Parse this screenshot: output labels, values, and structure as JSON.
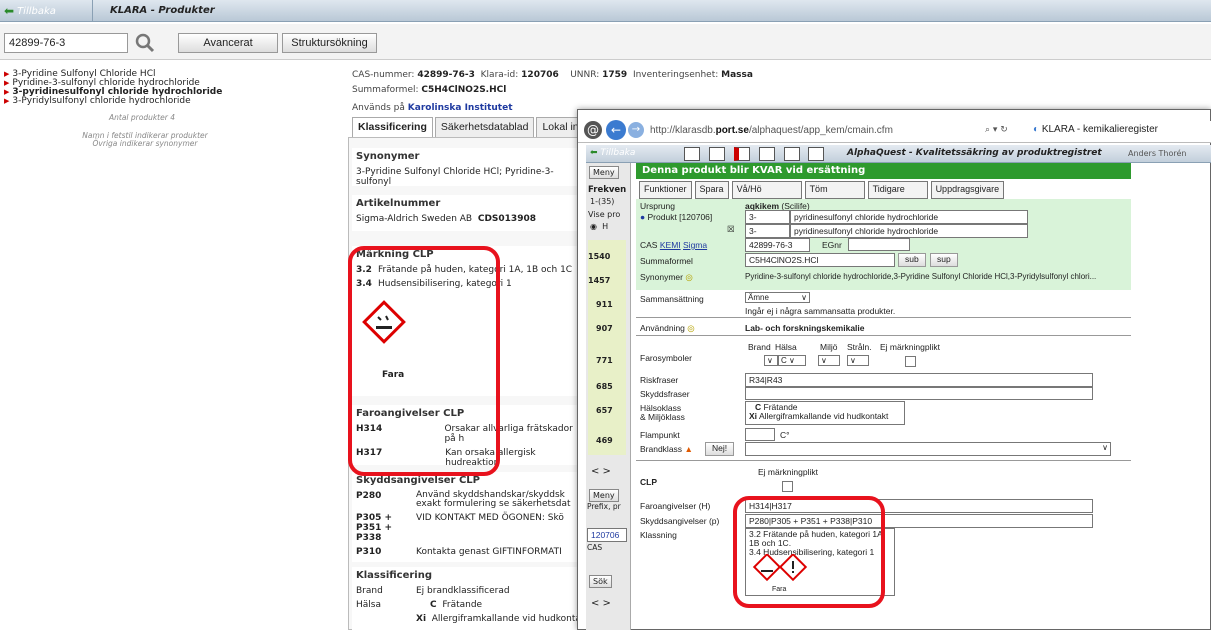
{
  "app": {
    "back_label": "Tillbaka",
    "title": "KLARA - Produkter"
  },
  "search": {
    "value": "42899-76-3",
    "advanced_label": "Avancerat",
    "structure_label": "Struktursökning"
  },
  "products": [
    "3-Pyridine Sulfonyl Chloride HCl",
    "Pyridine-3-sulfonyl chloride hydrochloride",
    "3-pyridinesulfonyl chloride hydrochloride",
    "3-Pyridylsulfonyl chloride hydrochloride"
  ],
  "product_count": "Antal produkter 4",
  "notes": [
    "Namn i fetstil indikerar produkter",
    "Övriga indikerar synonymer"
  ],
  "info": {
    "cas_label": "CAS-nummer:",
    "cas": "42899-76-3",
    "klara_label": "Klara-id:",
    "klara": "120706",
    "unnr_label": "UNNR:",
    "unnr": "1759",
    "unit_label": "Inventeringsenhet:",
    "unit": "Massa",
    "formula_label": "Summaformel:",
    "formula": "C5H4ClNO2S.HCl",
    "used_label": "Används på",
    "used": "Karolinska Institutet"
  },
  "tabs": [
    "Klassificering",
    "Säkerhetsdatablad",
    "Lokal inf"
  ],
  "synonyms": {
    "title": "Synonymer",
    "text": "3-Pyridine Sulfonyl Chloride HCl; Pyridine-3-sulfonyl"
  },
  "article": {
    "title": "Artikelnummer",
    "supplier": "Sigma-Aldrich Sweden AB",
    "code": "CDS013908"
  },
  "clp": {
    "title": "Märkning CLP",
    "rows": [
      {
        "code": "3.2",
        "text": "Frätande på huden, kategori 1A, 1B och 1C"
      },
      {
        "code": "3.4",
        "text": "Hudsensibilisering, kategori 1"
      }
    ],
    "signal": "Fara"
  },
  "hazards": {
    "title": "Faroangivelser CLP",
    "rows": [
      {
        "code": "H314",
        "text": "Orsakar allvarliga frätskador på h"
      },
      {
        "code": "H317",
        "text": "Kan orsaka allergisk hudreaktion"
      }
    ]
  },
  "precautions": {
    "title": "Skyddsangivelser CLP",
    "rows": [
      {
        "code": "P280",
        "text": "Använd skyddshandskar/skyddsk",
        "text2": "exakt formulering se säkerhetsdat"
      },
      {
        "code": "P305 + P351 + P338",
        "text": "VID KONTAKT MED ÖGONEN: Skö"
      },
      {
        "code": "P310",
        "text": "Kontakta genast GIFTINFORMATI"
      }
    ]
  },
  "classification": {
    "title": "Klassificering",
    "fire_label": "Brand",
    "fire": "Ej brandklassificerad",
    "health_label": "Hälsa",
    "h1_code": "C",
    "h1": "Frätande",
    "h2_code": "Xi",
    "h2": "Allergiframkallande vid hudkontakt"
  },
  "popup": {
    "url_prefix": "http://klarasdb.",
    "url_domain": "port.se",
    "url_rest": "/alphaquest/app_kem/cmain.cfm",
    "search_icons": "⌕ ▾ ↻",
    "tab": "KLARA - kemikalieregister",
    "back": "Tillbaka",
    "aq_title": "AlphaQuest - Kvalitetssäkring av produktregistret",
    "user": "Anders Thorén",
    "status_prefix": "Denna produkt blir",
    "status_bold": "KVAR",
    "status_suffix": "vid ersättning",
    "menu": [
      "Funktioner",
      "Spara",
      "Vå/Hö",
      "Töm",
      "Tidigare",
      "Uppdragsgivare"
    ],
    "left": {
      "meny": "Meny",
      "frek": "Frekven",
      "range": "1-(35)",
      "vise": "Vise pro",
      "h": "H",
      "nums": [
        "1540",
        "1457",
        "911",
        "907",
        "771",
        "685",
        "657",
        "469"
      ],
      "meny2": "Meny",
      "prefix": "Prefix, pr",
      "id": "120706",
      "cas": "CAS",
      "sok": "Sök"
    },
    "form": {
      "ursprung": "Ursprung",
      "ursprung_val": "aqkikem",
      "ursprung_src": "(Scilife)",
      "produkt": "Produkt [120706]",
      "p1a": "3-",
      "p1b": "pyridinesulfonyl chloride hydrochloride",
      "p2a": "3-",
      "p2b": "pyridinesulfonyl chloride hydrochloride",
      "cas": "CAS",
      "kemi": "KEMI",
      "sigma": "Sigma",
      "cas_val": "42899-76-3",
      "egnr": "EGnr",
      "summa": "Summaformel",
      "summa_val": "C5H4ClNO2S.HCl",
      "sub": "sub",
      "sup": "sup",
      "synonymer": "Synonymer",
      "syn_val": "Pyridine-3-sulfonyl chloride hydrochloride,3-Pyridine Sulfonyl Chloride HCl,3-Pyridylsulfonyl chlori...",
      "samman": "Sammansättning",
      "samman_val": "Ämne",
      "samman_note": "Ingår ej i några sammansatta produkter.",
      "anvandning": "Användning",
      "anvandning_val": "Lab- och forskningskemikalie",
      "cols": [
        "Brand",
        "Hälsa",
        "Miljö",
        "Stråln.",
        "Ej märkningplikt"
      ],
      "farosymboler": "Farosymboler",
      "halsa_val": "C",
      "riskfraser": "Riskfraser",
      "risk_val": "R34|R43",
      "skyddsfraser": "Skyddsfraser",
      "halsoklass": "Hälsoklass",
      "miljoklass": "& Miljöklass",
      "hk1code": "C",
      "hk1": "Frätande",
      "hk2code": "Xi",
      "hk2": "Allergiframkallande vid hudkontakt",
      "flampunkt": "Flampunkt",
      "celsius": "C°",
      "brandklass": "Brandklass",
      "nej": "Nej!",
      "ej_mark": "Ej märkningplikt",
      "clp": "CLP",
      "faro": "Faroangivelser (H)",
      "faro_val": "H314|H317",
      "skydd": "Skyddsangivelser (p)",
      "skydd_val": "P280|P305 + P351 + P338|P310",
      "klassning": "Klassning",
      "k1": "3.2  Frätande på huden, kategori 1A, 1B och 1C.",
      "k2": "3.4  Hudsensibilisering, kategori 1",
      "fara": "Fara"
    }
  },
  "colors": {
    "accent_red": "#e8121d",
    "green": "#2e9a2e",
    "form_bg": "#d9f3d9"
  }
}
